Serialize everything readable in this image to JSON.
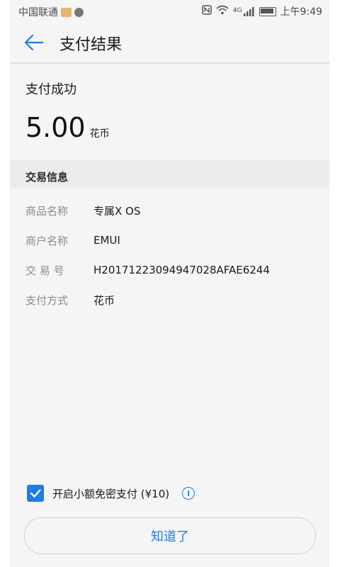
{
  "status_bar": {
    "carrier": "中国联通",
    "network": "4G",
    "time": "上午9:49"
  },
  "header": {
    "title": "支付结果"
  },
  "result": {
    "status": "支付成功",
    "amount": "5.00",
    "unit": "花币"
  },
  "section": {
    "title": "交易信息"
  },
  "info": [
    {
      "label": "商品名称",
      "value": "专属X OS"
    },
    {
      "label": "商户名称",
      "value": "EMUI"
    },
    {
      "label": "交 易 号",
      "value": "H20171223094947028AFAE6244"
    },
    {
      "label": "支付方式",
      "value": "花币"
    }
  ],
  "option": {
    "label": "开启小额免密支付 (¥10)",
    "checked": true,
    "info_icon": "info-icon"
  },
  "confirm_label": "知道了",
  "colors": {
    "accent": "#1e7ce8",
    "background": "#f5f5f5",
    "section_bg": "#ececec"
  }
}
